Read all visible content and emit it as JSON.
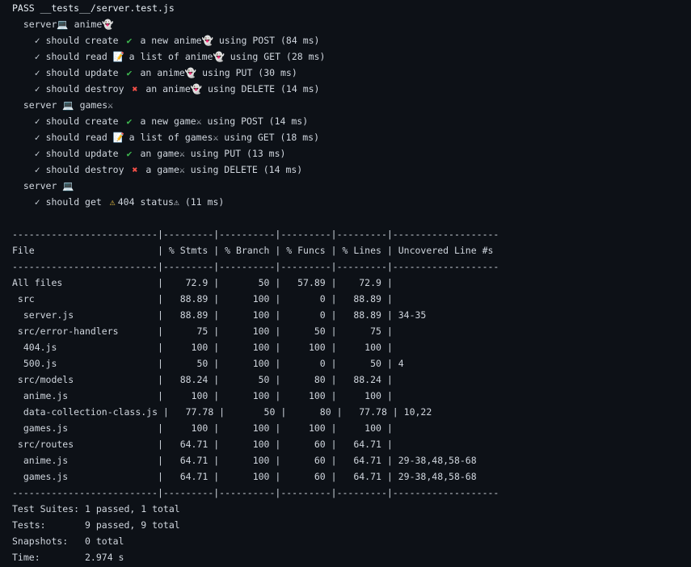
{
  "header": "PASS __tests__/server.test.js",
  "suites": [
    {
      "title": "server💻 anime👻",
      "tests": [
        {
          "mark": "✓",
          "text_before": "should create ",
          "icon": "✔",
          "icon_kind": "check",
          "text_after": " a new anime👻 using POST (84 ms)"
        },
        {
          "mark": "✓",
          "text_before": "should read ",
          "icon": "📝",
          "icon_kind": "memo",
          "text_after": " a list of anime👻 using GET (28 ms)"
        },
        {
          "mark": "✓",
          "text_before": "should update ",
          "icon": "✔",
          "icon_kind": "check",
          "text_after": " an anime👻 using PUT (30 ms)"
        },
        {
          "mark": "✓",
          "text_before": "should destroy ",
          "icon": "✖",
          "icon_kind": "cross",
          "text_after": " an anime👻 using DELETE (14 ms)"
        }
      ]
    },
    {
      "title": "server 💻 games⚔",
      "tests": [
        {
          "mark": "✓",
          "text_before": "should create ",
          "icon": "✔",
          "icon_kind": "check",
          "text_after": " a new game⚔ using POST (14 ms)"
        },
        {
          "mark": "✓",
          "text_before": "should read ",
          "icon": "📝",
          "icon_kind": "memo",
          "text_after": " a list of games⚔ using GET (18 ms)"
        },
        {
          "mark": "✓",
          "text_before": "should update ",
          "icon": "✔",
          "icon_kind": "check",
          "text_after": " an game⚔ using PUT (13 ms)"
        },
        {
          "mark": "✓",
          "text_before": "should destroy ",
          "icon": "✖",
          "icon_kind": "cross",
          "text_after": " a game⚔ using DELETE (14 ms)"
        }
      ]
    },
    {
      "title": "server 💻",
      "tests": [
        {
          "mark": "✓",
          "text_before": "should get ",
          "icon": "⚠",
          "icon_kind": "warning",
          "text_after": "404 status⚠ (11 ms)"
        }
      ]
    }
  ],
  "coverage": {
    "separator": "--------------------------|---------|----------|---------|---------|-------------------",
    "header_row": "File                      | % Stmts | % Branch | % Funcs | % Lines | Uncovered Line #s ",
    "rows": [
      "All files                 |    72.9 |       50 |   57.89 |    72.9 |                   ",
      " src                      |   88.89 |      100 |       0 |   88.89 |                   ",
      "  server.js               |   88.89 |      100 |       0 |   88.89 | 34-35             ",
      " src/error-handlers       |      75 |      100 |      50 |      75 |                   ",
      "  404.js                  |     100 |      100 |     100 |     100 |                   ",
      "  500.js                  |      50 |      100 |       0 |      50 | 4                 ",
      " src/models               |   88.24 |       50 |      80 |   88.24 |                   ",
      "  anime.js                |     100 |      100 |     100 |     100 |                   ",
      "  data-collection-class.js |   77.78 |       50 |      80 |   77.78 | 10,22             ",
      "  games.js                |     100 |      100 |     100 |     100 |                   ",
      " src/routes               |   64.71 |      100 |      60 |   64.71 |                   ",
      "  anime.js                |   64.71 |      100 |      60 |   64.71 | 29-38,48,58-68    ",
      "  games.js                |   64.71 |      100 |      60 |   64.71 | 29-38,48,58-68    "
    ]
  },
  "summary": [
    "Test Suites: 1 passed, 1 total",
    "Tests:       9 passed, 9 total",
    "Snapshots:   0 total",
    "Time:        2.974 s"
  ],
  "colors": {
    "background": "#0d1117",
    "text": "#d0d6de",
    "check": "#3fb950",
    "cross": "#f85149",
    "warning": "#f2c744"
  }
}
